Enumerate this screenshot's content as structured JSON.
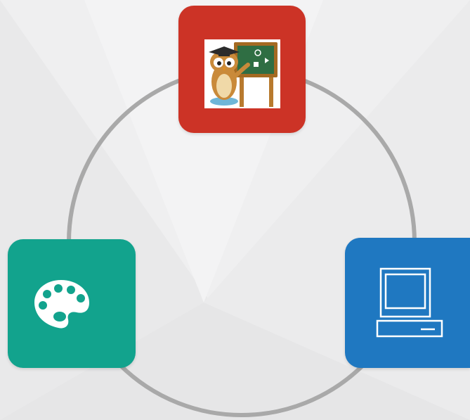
{
  "diagram": {
    "nodes": [
      {
        "id": "teaching",
        "icon": "owl-teacher-chalkboard-icon",
        "color": "#cc3326"
      },
      {
        "id": "art",
        "icon": "paint-palette-icon",
        "color": "#12a38d"
      },
      {
        "id": "technology",
        "icon": "computer-monitor-icon",
        "color": "#1f78c1"
      }
    ],
    "ring_color": "#a9a9a9",
    "background": "#eeeeef"
  }
}
